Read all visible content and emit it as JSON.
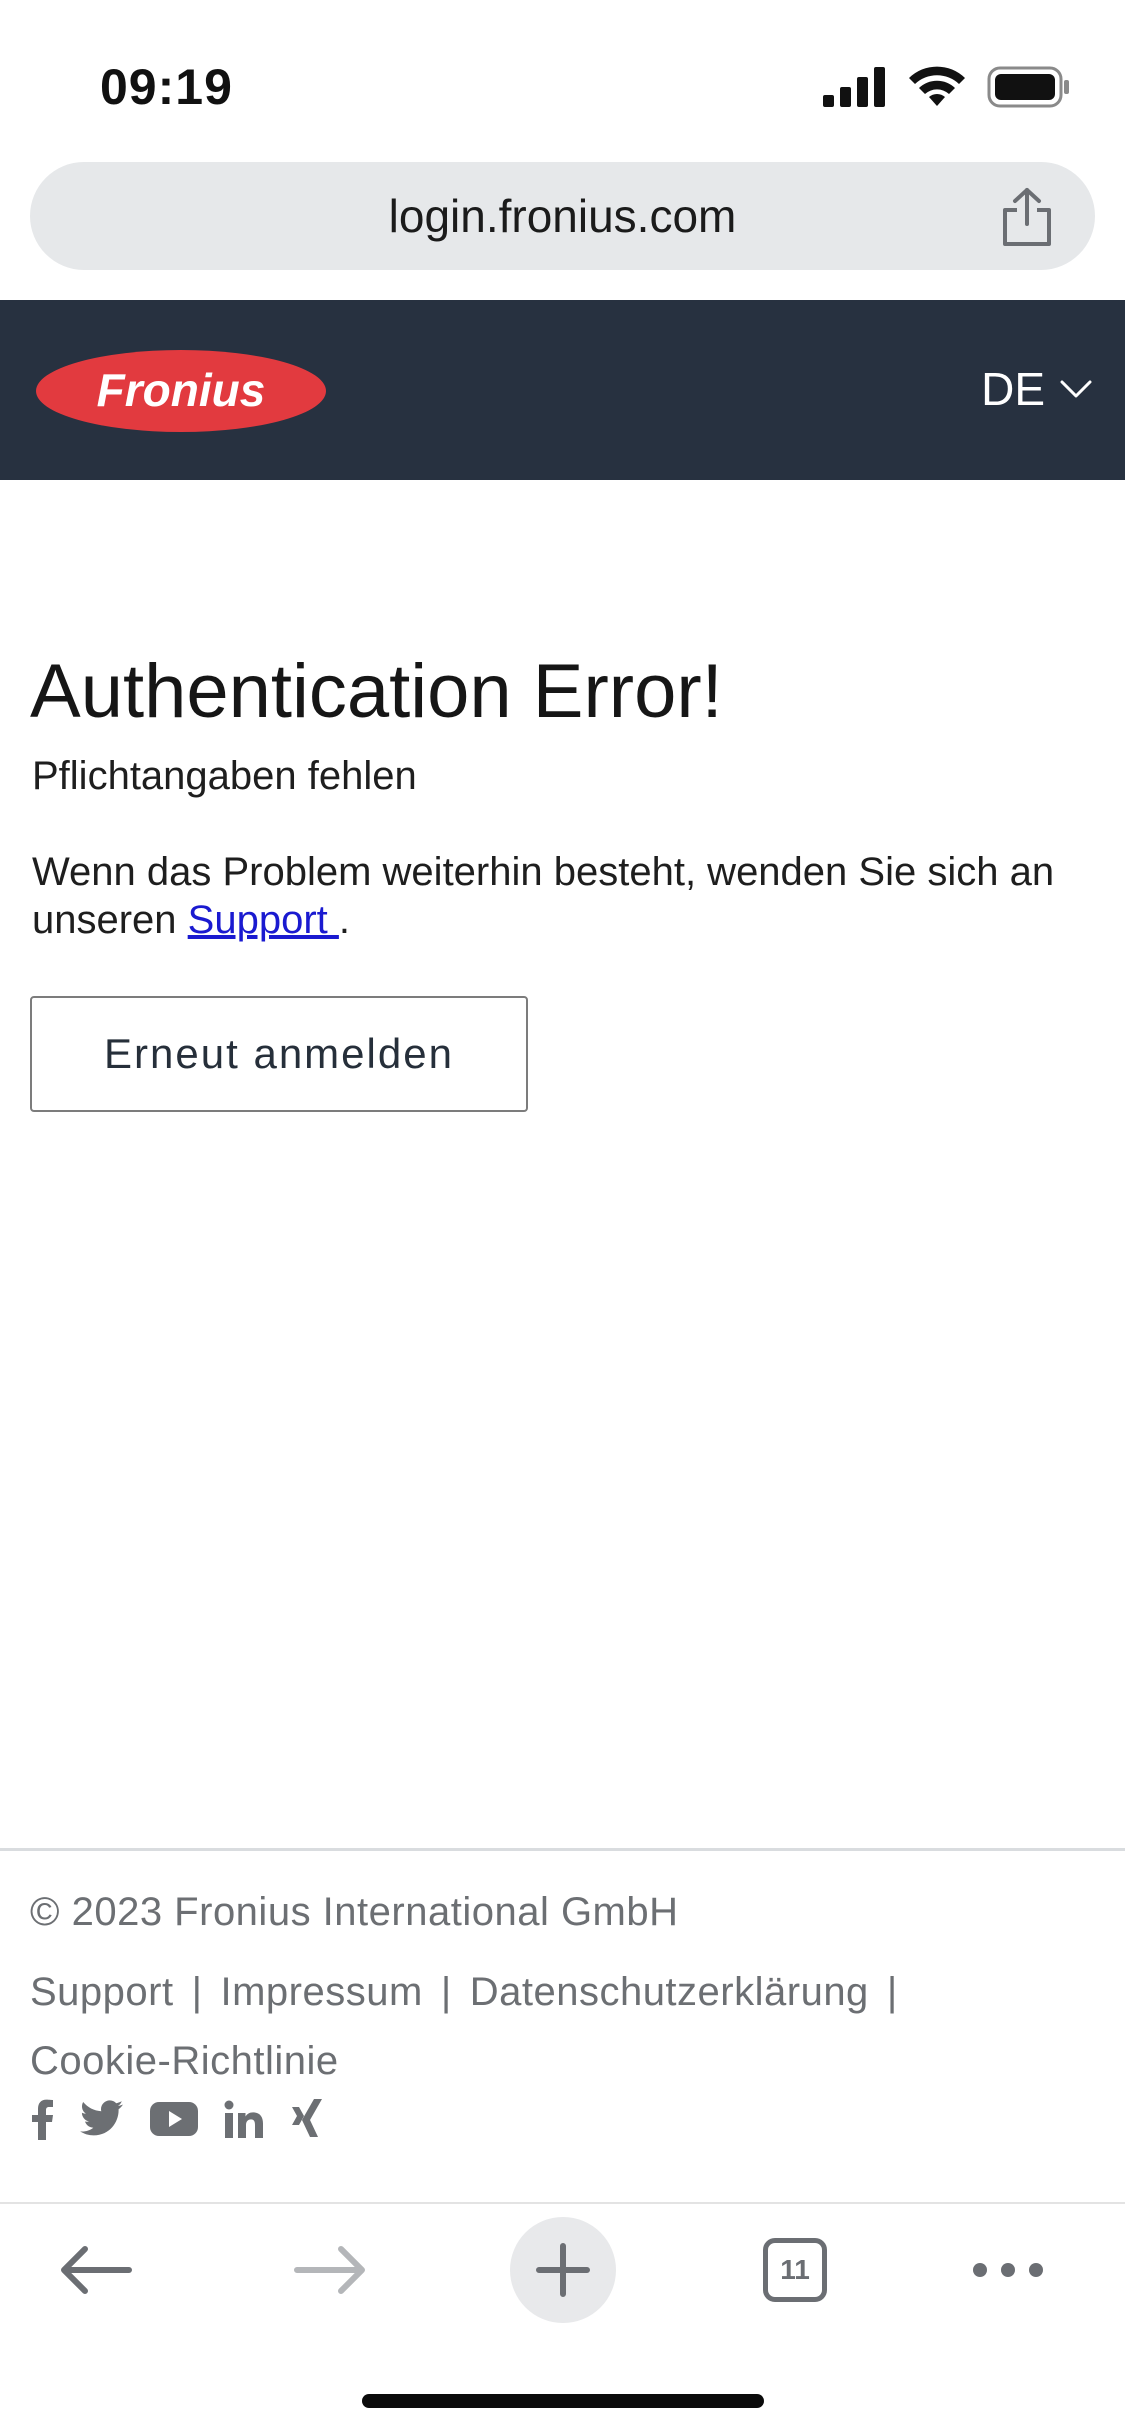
{
  "status_bar": {
    "time": "09:19"
  },
  "browser": {
    "url": "login.fronius.com",
    "tab_count": "11"
  },
  "header": {
    "logo_text": "Fronius",
    "language": "DE",
    "logo_color": "#e23a3f",
    "bg_color": "#273140"
  },
  "main": {
    "title": "Authentication Error!",
    "subtitle": "Pflichtangaben fehlen",
    "message_prefix": "Wenn das Problem weiterhin besteht, wenden Sie sich an unseren ",
    "support_link": "Support ",
    "message_suffix": ".",
    "retry_button": "Erneut anmelden"
  },
  "footer": {
    "copyright": "© 2023  Fronius International GmbH",
    "links": [
      "Support",
      "Impressum",
      "Datenschutzerklärung",
      "Cookie-Richtlinie"
    ],
    "separator": "|",
    "socials": [
      "facebook-icon",
      "twitter-icon",
      "youtube-icon",
      "linkedin-icon",
      "xing-icon"
    ]
  }
}
